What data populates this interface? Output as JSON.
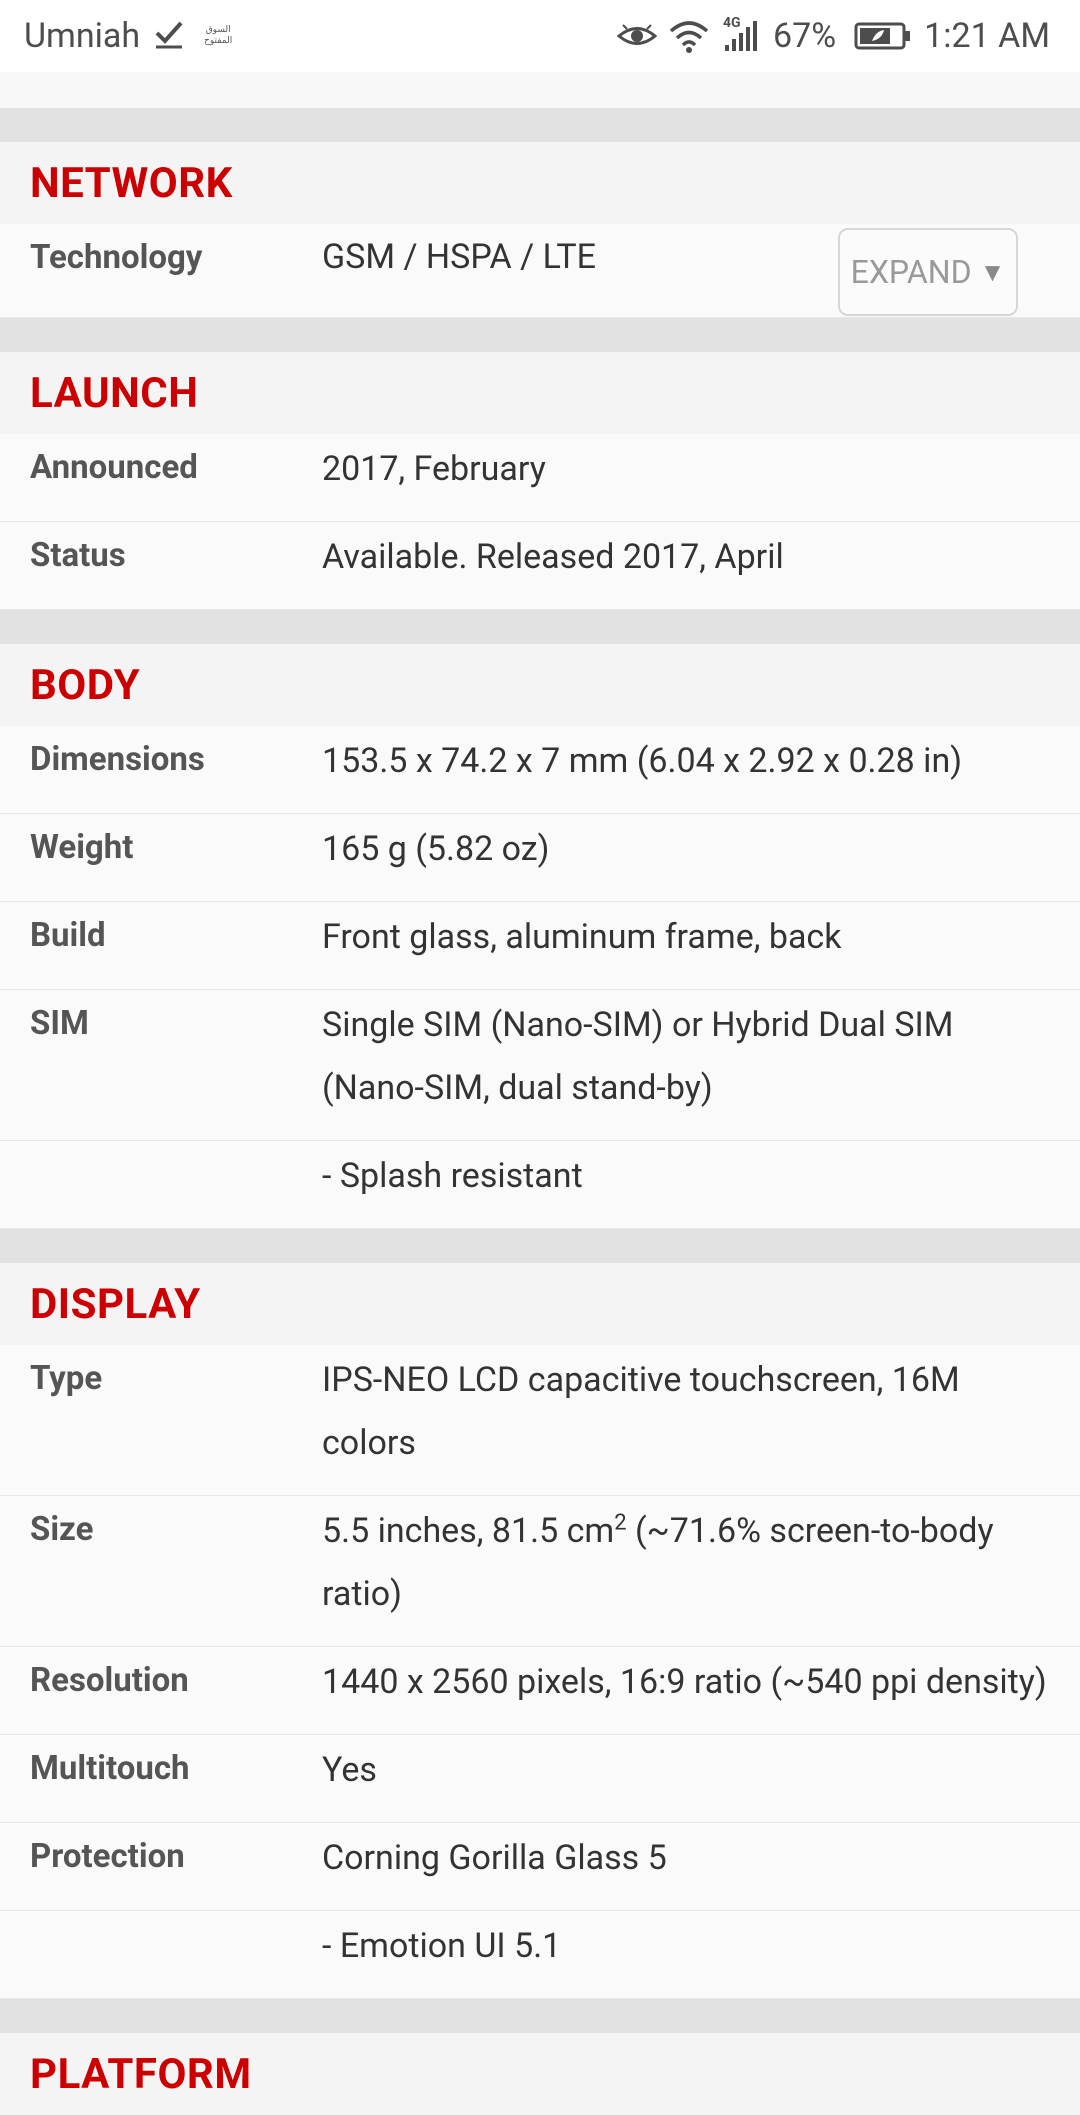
{
  "status_bar": {
    "carrier": "Umniah",
    "carrier_badge_line1": "السوق",
    "carrier_badge_line2": "المفتوح",
    "network_type": "4G",
    "battery_percent": "67%",
    "time": "1:21 AM"
  },
  "sections": {
    "network": {
      "title": "NETWORK",
      "technology_label": "Technology",
      "technology_value": "GSM / HSPA / LTE",
      "expand_label": "EXPAND",
      "expand_arrow": "▼"
    },
    "launch": {
      "title": "LAUNCH",
      "announced_label": "Announced",
      "announced_value": "2017, February",
      "status_label": "Status",
      "status_value": "Available. Released 2017, April"
    },
    "body": {
      "title": "BODY",
      "dimensions_label": "Dimensions",
      "dimensions_value": "153.5 x 74.2 x 7 mm (6.04 x 2.92 x 0.28 in)",
      "weight_label": "Weight",
      "weight_value": "165 g (5.82 oz)",
      "build_label": "Build",
      "build_value": "Front glass, aluminum frame, back",
      "sim_label": "SIM",
      "sim_value": "Single SIM (Nano-SIM) or Hybrid Dual SIM (Nano-SIM, dual stand-by)",
      "extra_value": "- Splash resistant"
    },
    "display": {
      "title": "DISPLAY",
      "type_label": "Type",
      "type_value": "IPS-NEO LCD capacitive touchscreen, 16M colors",
      "size_label": "Size",
      "size_value_pre": "5.5 inches, 81.5 cm",
      "size_sup": "2",
      "size_value_post": " (~71.6% screen-to-body ratio)",
      "resolution_label": "Resolution",
      "resolution_value": "1440 x 2560 pixels, 16:9 ratio (~540 ppi density)",
      "multitouch_label": "Multitouch",
      "multitouch_value": "Yes",
      "protection_label": "Protection",
      "protection_value": "Corning Gorilla Glass 5",
      "extra_value": "- Emotion UI 5.1"
    },
    "platform": {
      "title": "PLATFORM"
    }
  },
  "colors": {
    "section_title": "#cc0000",
    "gap": "#e2e2e2",
    "row_bg": "#fafafa"
  }
}
